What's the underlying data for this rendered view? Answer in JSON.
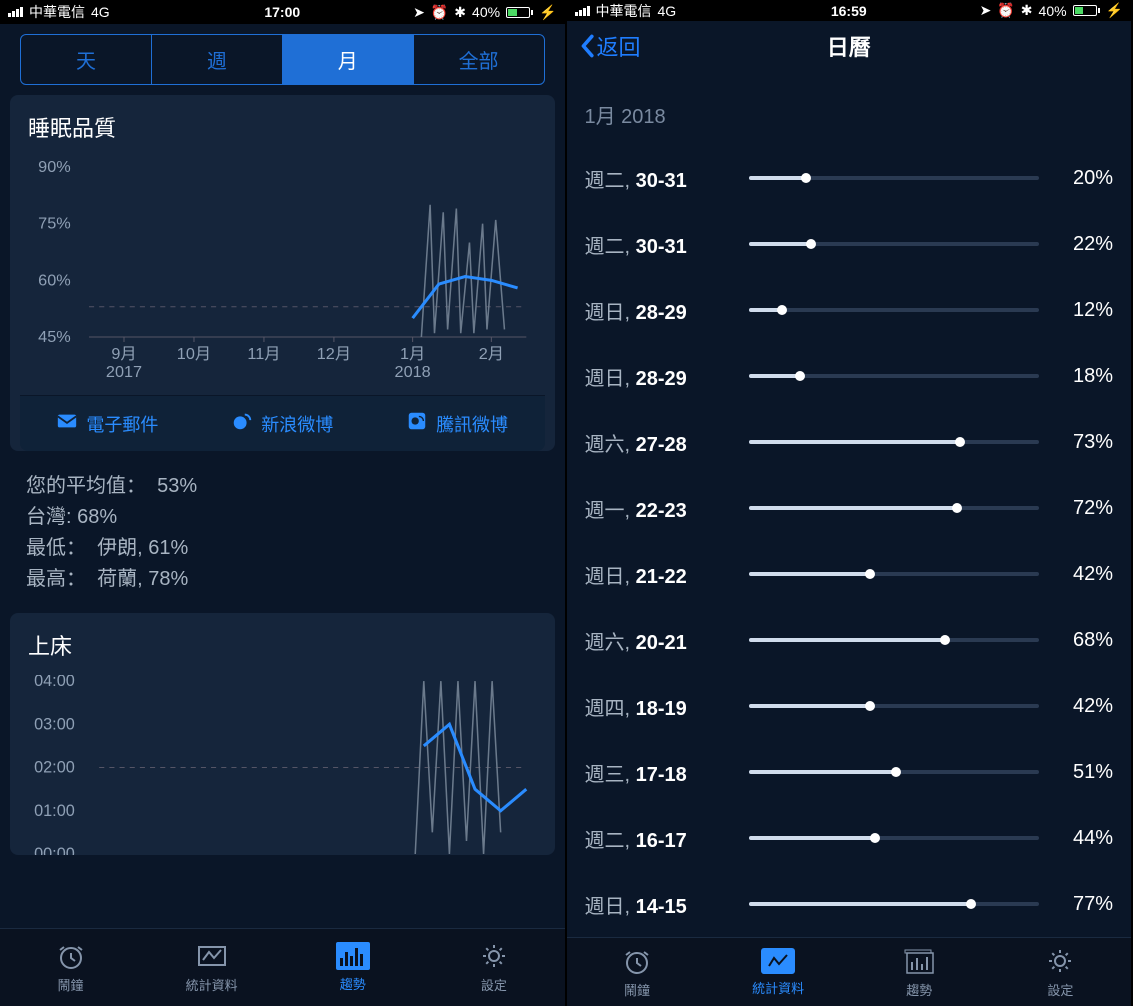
{
  "left": {
    "status": {
      "carrier": "中華電信",
      "network": "4G",
      "time": "17:00",
      "battery_pct": "40%"
    },
    "segments": [
      "天",
      "週",
      "月",
      "全部"
    ],
    "active_segment": 2,
    "quality_card": {
      "title": "睡眠品質",
      "share": [
        {
          "key": "email",
          "label": "電子郵件"
        },
        {
          "key": "sina",
          "label": "新浪微博"
        },
        {
          "key": "tencent",
          "label": "騰訊微博"
        }
      ]
    },
    "stats": {
      "avg_label": "您的平均值：",
      "avg_value": "53%",
      "tw_label": "台灣:",
      "tw_value": "68%",
      "low_label": "最低：",
      "low_value": "伊朗, 61%",
      "high_label": "最高：",
      "high_value": "荷蘭, 78%"
    },
    "bed_card": {
      "title": "上床"
    },
    "tabs": [
      "鬧鐘",
      "統計資料",
      "趨勢",
      "設定"
    ],
    "active_tab": 2
  },
  "right": {
    "status": {
      "carrier": "中華電信",
      "network": "4G",
      "time": "16:59",
      "battery_pct": "40%"
    },
    "back_label": "返回",
    "nav_title": "日曆",
    "section": "1月 2018",
    "rows": [
      {
        "dow": "週二",
        "range": "30-31",
        "pct": 20
      },
      {
        "dow": "週二",
        "range": "30-31",
        "pct": 22
      },
      {
        "dow": "週日",
        "range": "28-29",
        "pct": 12
      },
      {
        "dow": "週日",
        "range": "28-29",
        "pct": 18
      },
      {
        "dow": "週六",
        "range": "27-28",
        "pct": 73
      },
      {
        "dow": "週一",
        "range": "22-23",
        "pct": 72
      },
      {
        "dow": "週日",
        "range": "21-22",
        "pct": 42
      },
      {
        "dow": "週六",
        "range": "20-21",
        "pct": 68
      },
      {
        "dow": "週四",
        "range": "18-19",
        "pct": 42
      },
      {
        "dow": "週三",
        "range": "17-18",
        "pct": 51
      },
      {
        "dow": "週二",
        "range": "16-17",
        "pct": 44
      },
      {
        "dow": "週日",
        "range": "14-15",
        "pct": 77
      }
    ],
    "tabs": [
      "鬧鐘",
      "統計資料",
      "趨勢",
      "設定"
    ],
    "active_tab": 1
  },
  "chart_data": [
    {
      "type": "line",
      "title": "睡眠品質",
      "ylabel": "%",
      "y_ticks": [
        "90%",
        "75%",
        "60%",
        "45%"
      ],
      "ylim": [
        45,
        90
      ],
      "x_ticks": [
        {
          "label": "9月",
          "sub": "2017"
        },
        {
          "label": "10月",
          "sub": ""
        },
        {
          "label": "11月",
          "sub": ""
        },
        {
          "label": "12月",
          "sub": ""
        },
        {
          "label": "1月",
          "sub": "2018"
        },
        {
          "label": "2月",
          "sub": ""
        }
      ],
      "reference_line": 53,
      "smooth_series": {
        "name": "trend",
        "x": [
          0.74,
          0.8,
          0.86,
          0.92,
          0.98
        ],
        "y": [
          50,
          59,
          61,
          60,
          58
        ]
      },
      "raw_series": {
        "name": "daily",
        "x": [
          0.76,
          0.78,
          0.79,
          0.81,
          0.82,
          0.84,
          0.85,
          0.87,
          0.88,
          0.9,
          0.91,
          0.93,
          0.95
        ],
        "y": [
          45,
          80,
          46,
          78,
          47,
          79,
          46,
          70,
          46,
          75,
          47,
          76,
          47
        ]
      }
    },
    {
      "type": "line",
      "title": "上床",
      "ylabel": "time",
      "y_ticks": [
        "04:00",
        "03:00",
        "02:00",
        "01:00",
        "00:00"
      ],
      "ylim_hours": [
        0,
        4
      ],
      "reference_line_hours": 2,
      "smooth_series": {
        "name": "trend",
        "x": [
          0.76,
          0.82,
          0.88,
          0.94,
          1.0
        ],
        "y_hours": [
          2.5,
          3.0,
          1.5,
          1.0,
          1.5
        ]
      },
      "raw_series": {
        "name": "daily",
        "x": [
          0.74,
          0.76,
          0.78,
          0.8,
          0.82,
          0.84,
          0.86,
          0.88,
          0.9,
          0.92,
          0.94
        ],
        "y_hours": [
          0,
          4,
          0.5,
          4,
          0,
          4,
          0.3,
          4,
          0,
          4,
          0.5
        ]
      }
    }
  ]
}
